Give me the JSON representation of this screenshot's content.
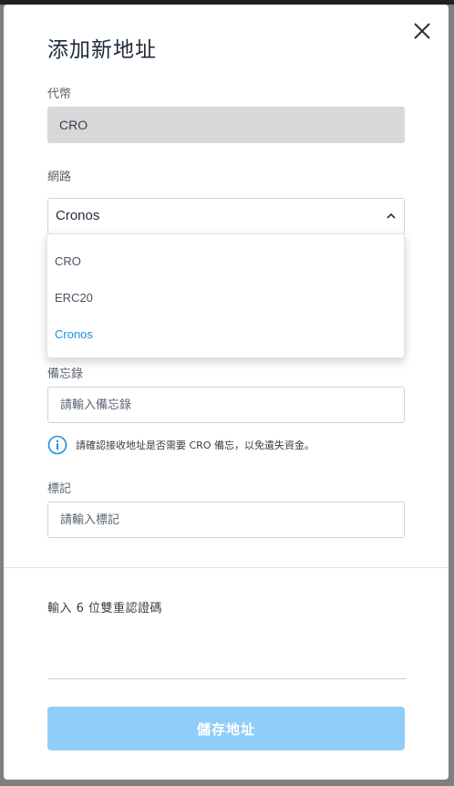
{
  "modal": {
    "title": "添加新地址",
    "close_icon": "close-icon"
  },
  "token": {
    "label": "代幣",
    "value": "CRO"
  },
  "network": {
    "label": "網路",
    "selected": "Cronos",
    "options": [
      "CRO",
      "ERC20",
      "Cronos"
    ],
    "selected_color": "#1b8fe0"
  },
  "memo": {
    "label": "備忘錄",
    "placeholder": "請輸入備忘錄",
    "info": "請確認接收地址是否需要 CRO 備忘，以免遺失資金。",
    "info_icon": "info-icon",
    "info_color": "#1b8fe0"
  },
  "tag": {
    "label": "標記",
    "placeholder": "請輸入標記"
  },
  "otp": {
    "label": "輸入 6 位雙重認證碼",
    "digits": [
      "",
      "",
      "",
      "",
      "",
      ""
    ]
  },
  "save_button": {
    "label": "儲存地址",
    "color": "#90cdf8"
  }
}
